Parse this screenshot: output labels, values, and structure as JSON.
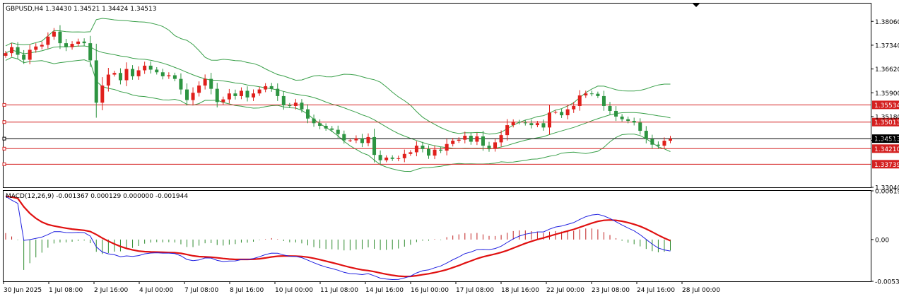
{
  "header": {
    "symbol_info": "GBPUSD,H4  1.34430 1.34521 1.34424 1.34513"
  },
  "macd_header": "MACD(12,26,9) -0.001367 0.000129 0.000000 -0.001944",
  "colors": {
    "bull": "#e0201c",
    "bear": "#2d9441",
    "band": "#3aa04a",
    "hline": "#d42020",
    "macd_main": "#2020e0",
    "macd_signal": "#e01010",
    "hist": "#2d8a2d",
    "hist_pos": "#c02020"
  },
  "chart_data": [
    {
      "type": "candlestick",
      "symbol": "GBPUSD",
      "timeframe": "H4",
      "ylim": [
        1.3304,
        1.386
      ],
      "y_ticks": [
        "1.38060",
        "1.37340",
        "1.36620",
        "1.35900",
        "1.35180",
        "1.34460",
        "1.33040"
      ],
      "x_ticks": [
        "30 Jun 2025",
        "1 Jul 08:00",
        "2 Jul 16:00",
        "4 Jul 00:00",
        "7 Jul 08:00",
        "8 Jul 16:00",
        "10 Jul 00:00",
        "11 Jul 08:00",
        "14 Jul 16:00",
        "16 Jul 00:00",
        "17 Jul 08:00",
        "18 Jul 16:00",
        "22 Jul 00:00",
        "23 Jul 08:00",
        "24 Jul 16:00",
        "28 Jul 00:00"
      ],
      "price_lines": [
        {
          "label": "1.35534",
          "value": 1.35534,
          "style": "red"
        },
        {
          "label": "1.35013",
          "value": 1.35013,
          "style": "red"
        },
        {
          "label": "1.34513",
          "value": 1.34513,
          "style": "current"
        },
        {
          "label": "1.34210",
          "value": 1.3421,
          "style": "red"
        },
        {
          "label": "1.33739",
          "value": 1.33739,
          "style": "red"
        }
      ],
      "candles_close": [
        1.371,
        1.3728,
        1.3705,
        1.369,
        1.372,
        1.373,
        1.3735,
        1.376,
        1.3775,
        1.374,
        1.3728,
        1.3738,
        1.3745,
        1.374,
        1.3688,
        1.356,
        1.3612,
        1.3645,
        1.365,
        1.3628,
        1.3662,
        1.364,
        1.3658,
        1.3672,
        1.366,
        1.3652,
        1.364,
        1.3643,
        1.3632,
        1.36,
        1.3568,
        1.359,
        1.3612,
        1.3632,
        1.3602,
        1.3562,
        1.357,
        1.3588,
        1.358,
        1.3596,
        1.3576,
        1.3588,
        1.36,
        1.361,
        1.3602,
        1.358,
        1.3552,
        1.355,
        1.356,
        1.354,
        1.3512,
        1.3498,
        1.349,
        1.3482,
        1.3478,
        1.3465,
        1.3446,
        1.3446,
        1.3452,
        1.3438,
        1.3456,
        1.3402,
        1.3386,
        1.3394,
        1.339,
        1.3392,
        1.3405,
        1.341,
        1.343,
        1.342,
        1.34,
        1.3418,
        1.3415,
        1.3435,
        1.3445,
        1.3448,
        1.346,
        1.3442,
        1.3458,
        1.343,
        1.3422,
        1.344,
        1.3462,
        1.3492,
        1.3502,
        1.35,
        1.3498,
        1.3492,
        1.3498,
        1.3485,
        1.353,
        1.3532,
        1.3522,
        1.354,
        1.355,
        1.3582,
        1.3588,
        1.3587,
        1.358,
        1.355,
        1.3535,
        1.3518,
        1.351,
        1.3505,
        1.35,
        1.3475,
        1.345,
        1.3433,
        1.343,
        1.3445,
        1.3451
      ]
    },
    {
      "type": "line",
      "name": "MACD(12,26,9)",
      "ylim": [
        -0.00531,
        0.00619
      ],
      "y_ticks": [
        "0.00619",
        "0.00",
        "-0.00531"
      ],
      "series_values": {
        "macd": -0.001367,
        "signal": 0.000129,
        "value3": 0.0,
        "value4": -0.001944
      }
    }
  ]
}
